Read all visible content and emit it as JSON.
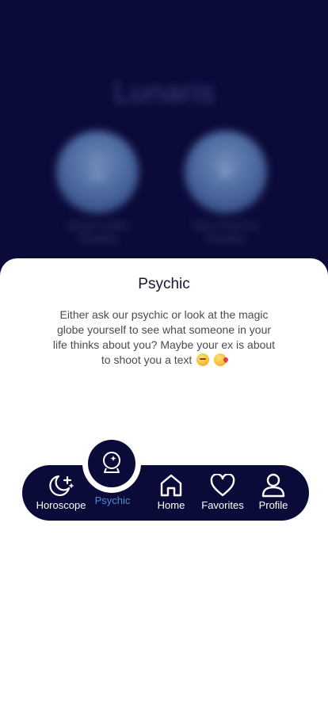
{
  "background": {
    "app_title": "Lunaris",
    "cards": [
      {
        "label_line1": "Virtual Coffee",
        "label_line2": "Reading"
      },
      {
        "label_line1": "Take Photo for",
        "label_line2": "Reading"
      }
    ]
  },
  "sheet": {
    "title": "Psychic",
    "description": "Either ask our psychic or look at the magic globe yourself to see what someone in your life thinks about you? Maybe your ex is about to shoot you a text"
  },
  "tabs": [
    {
      "label": "Horoscope",
      "icon": "moon-stars-icon"
    },
    {
      "label": "Psychic",
      "icon": "crystal-ball-icon",
      "active": true
    },
    {
      "label": "Home",
      "icon": "home-icon"
    },
    {
      "label": "Favorites",
      "icon": "heart-icon"
    },
    {
      "label": "Profile",
      "icon": "user-icon"
    }
  ],
  "colors": {
    "navy": "#0b0b3a",
    "active_tab": "#4a8fd6",
    "sheet_bg": "#ffffff"
  }
}
